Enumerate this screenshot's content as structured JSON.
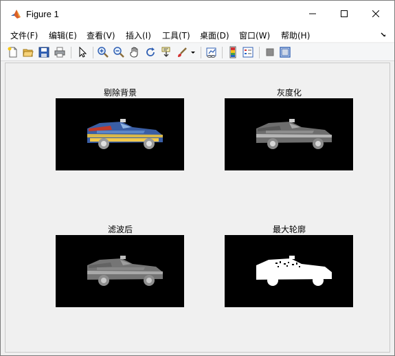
{
  "window": {
    "title": "Figure 1",
    "icon": "matlab-icon",
    "controls": [
      "minimize-icon",
      "maximize-icon",
      "close-icon"
    ]
  },
  "menu": {
    "items": [
      "文件(F)",
      "编辑(E)",
      "查看(V)",
      "插入(I)",
      "工具(T)",
      "桌面(D)",
      "窗口(W)",
      "帮助(H)"
    ]
  },
  "toolbar": {
    "icons": [
      "new-figure-icon",
      "open-file-icon",
      "save-icon",
      "print-icon",
      "select-arrow-icon",
      "zoom-in-icon",
      "zoom-out-icon",
      "pan-hand-icon",
      "rotate-3d-icon",
      "data-cursor-icon",
      "brush-icon",
      "brush-dropdown-icon",
      "link-plot-icon",
      "colorbar-icon",
      "legend-icon",
      "hide-plot-tools-icon",
      "show-plot-tools-icon"
    ]
  },
  "subplots": [
    {
      "title": "剔除背景",
      "image": "color car, background removed"
    },
    {
      "title": "灰度化",
      "image": "grayscale car"
    },
    {
      "title": "滤波后",
      "image": "filtered grayscale car"
    },
    {
      "title": "最大轮廓",
      "image": "white binary car contour"
    }
  ],
  "colors": {
    "figure_bg": "#f0f0f0",
    "axes_bg": "#000000"
  }
}
